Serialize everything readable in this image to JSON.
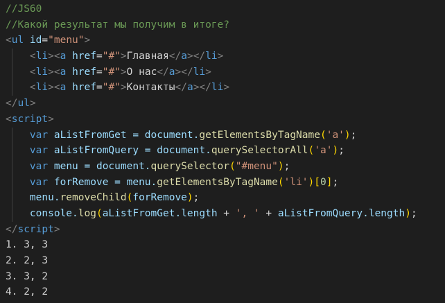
{
  "theme": {
    "background": "#1e1e1e",
    "comment": "#6a9955",
    "tag": "#569cd6",
    "attr": "#9cdcfe",
    "string": "#ce9178",
    "bracket": "#808080",
    "text": "#d4d4d4",
    "function": "#dcdcaa",
    "number": "#b5cea8",
    "paren_gold": "#ffd700",
    "paren_pink": "#da70d6"
  },
  "code": {
    "lines": [
      {
        "tokens": [
          {
            "t": "//JS60",
            "c": "comment"
          }
        ]
      },
      {
        "tokens": [
          {
            "t": "//Какой результат мы получим в итоге?",
            "c": "comment"
          }
        ]
      },
      {
        "tokens": [
          {
            "t": "<",
            "c": "bracket"
          },
          {
            "t": "ul",
            "c": "tag"
          },
          {
            "t": " ",
            "c": "text"
          },
          {
            "t": "id",
            "c": "attr"
          },
          {
            "t": "=",
            "c": "text"
          },
          {
            "t": "\"menu\"",
            "c": "string"
          },
          {
            "t": ">",
            "c": "bracket"
          }
        ]
      },
      {
        "indent": 1,
        "tokens": [
          {
            "t": "<",
            "c": "bracket"
          },
          {
            "t": "li",
            "c": "tag"
          },
          {
            "t": ">",
            "c": "bracket"
          },
          {
            "t": "<",
            "c": "bracket"
          },
          {
            "t": "a",
            "c": "tag"
          },
          {
            "t": " ",
            "c": "text"
          },
          {
            "t": "href",
            "c": "attr"
          },
          {
            "t": "=",
            "c": "text"
          },
          {
            "t": "\"#\"",
            "c": "string"
          },
          {
            "t": ">",
            "c": "bracket"
          },
          {
            "t": "Главная",
            "c": "text"
          },
          {
            "t": "</",
            "c": "bracket"
          },
          {
            "t": "a",
            "c": "tag"
          },
          {
            "t": ">",
            "c": "bracket"
          },
          {
            "t": "</",
            "c": "bracket"
          },
          {
            "t": "li",
            "c": "tag"
          },
          {
            "t": ">",
            "c": "bracket"
          }
        ]
      },
      {
        "indent": 1,
        "tokens": [
          {
            "t": "<",
            "c": "bracket"
          },
          {
            "t": "li",
            "c": "tag"
          },
          {
            "t": ">",
            "c": "bracket"
          },
          {
            "t": "<",
            "c": "bracket"
          },
          {
            "t": "a",
            "c": "tag"
          },
          {
            "t": " ",
            "c": "text"
          },
          {
            "t": "href",
            "c": "attr"
          },
          {
            "t": "=",
            "c": "text"
          },
          {
            "t": "\"#\"",
            "c": "string"
          },
          {
            "t": ">",
            "c": "bracket"
          },
          {
            "t": "О нас",
            "c": "text"
          },
          {
            "t": "</",
            "c": "bracket"
          },
          {
            "t": "a",
            "c": "tag"
          },
          {
            "t": ">",
            "c": "bracket"
          },
          {
            "t": "</",
            "c": "bracket"
          },
          {
            "t": "li",
            "c": "tag"
          },
          {
            "t": ">",
            "c": "bracket"
          }
        ]
      },
      {
        "indent": 1,
        "tokens": [
          {
            "t": "<",
            "c": "bracket"
          },
          {
            "t": "li",
            "c": "tag"
          },
          {
            "t": ">",
            "c": "bracket"
          },
          {
            "t": "<",
            "c": "bracket"
          },
          {
            "t": "a",
            "c": "tag"
          },
          {
            "t": " ",
            "c": "text"
          },
          {
            "t": "href",
            "c": "attr"
          },
          {
            "t": "=",
            "c": "text"
          },
          {
            "t": "\"#\"",
            "c": "string"
          },
          {
            "t": ">",
            "c": "bracket"
          },
          {
            "t": "Контакты",
            "c": "text"
          },
          {
            "t": "</",
            "c": "bracket"
          },
          {
            "t": "a",
            "c": "tag"
          },
          {
            "t": ">",
            "c": "bracket"
          },
          {
            "t": "</",
            "c": "bracket"
          },
          {
            "t": "li",
            "c": "tag"
          },
          {
            "t": ">",
            "c": "bracket"
          }
        ]
      },
      {
        "tokens": [
          {
            "t": "</",
            "c": "bracket"
          },
          {
            "t": "ul",
            "c": "tag"
          },
          {
            "t": ">",
            "c": "bracket"
          }
        ]
      },
      {
        "tokens": [
          {
            "t": "<",
            "c": "bracket"
          },
          {
            "t": "script",
            "c": "tag"
          },
          {
            "t": ">",
            "c": "bracket"
          }
        ]
      },
      {
        "indent": 1,
        "tokens": [
          {
            "t": "var",
            "c": "tag"
          },
          {
            "t": " aListFromGet = document.",
            "c": "attr"
          },
          {
            "t": "getElementsByTagName",
            "c": "function"
          },
          {
            "t": "(",
            "c": "paren_gold"
          },
          {
            "t": "'a'",
            "c": "string"
          },
          {
            "t": ")",
            "c": "paren_gold"
          },
          {
            "t": ";",
            "c": "text"
          }
        ]
      },
      {
        "indent": 1,
        "tokens": [
          {
            "t": "var",
            "c": "tag"
          },
          {
            "t": " aListFromQuery = document.",
            "c": "attr"
          },
          {
            "t": "querySelectorAll",
            "c": "function"
          },
          {
            "t": "(",
            "c": "paren_gold"
          },
          {
            "t": "'a'",
            "c": "string"
          },
          {
            "t": ")",
            "c": "paren_gold"
          },
          {
            "t": ";",
            "c": "text"
          }
        ]
      },
      {
        "indent": 1,
        "tokens": [
          {
            "t": "var",
            "c": "tag"
          },
          {
            "t": " menu = document.",
            "c": "attr"
          },
          {
            "t": "querySelector",
            "c": "function"
          },
          {
            "t": "(",
            "c": "paren_gold"
          },
          {
            "t": "\"#menu\"",
            "c": "string"
          },
          {
            "t": ")",
            "c": "paren_gold"
          },
          {
            "t": ";",
            "c": "text"
          }
        ]
      },
      {
        "indent": 1,
        "tokens": [
          {
            "t": "var",
            "c": "tag"
          },
          {
            "t": " forRemove = menu.",
            "c": "attr"
          },
          {
            "t": "getElementsByTagName",
            "c": "function"
          },
          {
            "t": "(",
            "c": "paren_gold"
          },
          {
            "t": "'li'",
            "c": "string"
          },
          {
            "t": ")",
            "c": "paren_gold"
          },
          {
            "t": "[",
            "c": "paren_gold"
          },
          {
            "t": "0",
            "c": "number"
          },
          {
            "t": "]",
            "c": "paren_gold"
          },
          {
            "t": ";",
            "c": "text"
          }
        ]
      },
      {
        "indent": 1,
        "tokens": [
          {
            "t": "menu.",
            "c": "attr"
          },
          {
            "t": "removeChild",
            "c": "function"
          },
          {
            "t": "(",
            "c": "paren_gold"
          },
          {
            "t": "forRemove",
            "c": "attr"
          },
          {
            "t": ")",
            "c": "paren_gold"
          },
          {
            "t": ";",
            "c": "text"
          }
        ]
      },
      {
        "indent": 1,
        "tokens": [
          {
            "t": "console.",
            "c": "attr"
          },
          {
            "t": "log",
            "c": "function"
          },
          {
            "t": "(",
            "c": "paren_gold"
          },
          {
            "t": "aListFromGet.length",
            "c": "attr"
          },
          {
            "t": " + ",
            "c": "text"
          },
          {
            "t": "', '",
            "c": "string"
          },
          {
            "t": " + ",
            "c": "text"
          },
          {
            "t": "aListFromQuery.length",
            "c": "attr"
          },
          {
            "t": ")",
            "c": "paren_gold"
          },
          {
            "t": ";",
            "c": "text"
          }
        ]
      },
      {
        "tokens": [
          {
            "t": "</",
            "c": "bracket"
          },
          {
            "t": "script",
            "c": "tag"
          },
          {
            "t": ">",
            "c": "bracket"
          }
        ]
      },
      {
        "tokens": [
          {
            "t": "1. 3, 3",
            "c": "text"
          }
        ]
      },
      {
        "tokens": [
          {
            "t": "2. 2, 3",
            "c": "text"
          }
        ]
      },
      {
        "tokens": [
          {
            "t": "3. 3, 2",
            "c": "text"
          }
        ]
      },
      {
        "tokens": [
          {
            "t": "4. 2, 2",
            "c": "text"
          }
        ]
      }
    ]
  }
}
